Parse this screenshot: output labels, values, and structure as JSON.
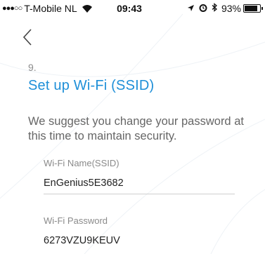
{
  "status_bar": {
    "signal": "●●●○○",
    "carrier": "T-Mobile NL",
    "time": "09:43",
    "battery_percent": "93%",
    "battery_level": 0.93,
    "icons": [
      "wifi-icon",
      "location-arrow-icon",
      "alarm-icon",
      "bluetooth-icon",
      "battery-icon"
    ]
  },
  "nav": {
    "back_icon": "chevron-left-icon"
  },
  "step": {
    "number": "9.",
    "title": "Set up Wi-Fi (SSID)",
    "description": "We suggest you change your password at this time to maintain security."
  },
  "form": {
    "ssid": {
      "label": "Wi-Fi Name(SSID)",
      "value": "EnGenius5E3682"
    },
    "password": {
      "label": "Wi-Fi Password",
      "value": "6273VZU9KEUV"
    }
  },
  "colors": {
    "accent": "#1e8fd8",
    "muted_text": "#666666",
    "label_text": "#8a8a8a"
  }
}
